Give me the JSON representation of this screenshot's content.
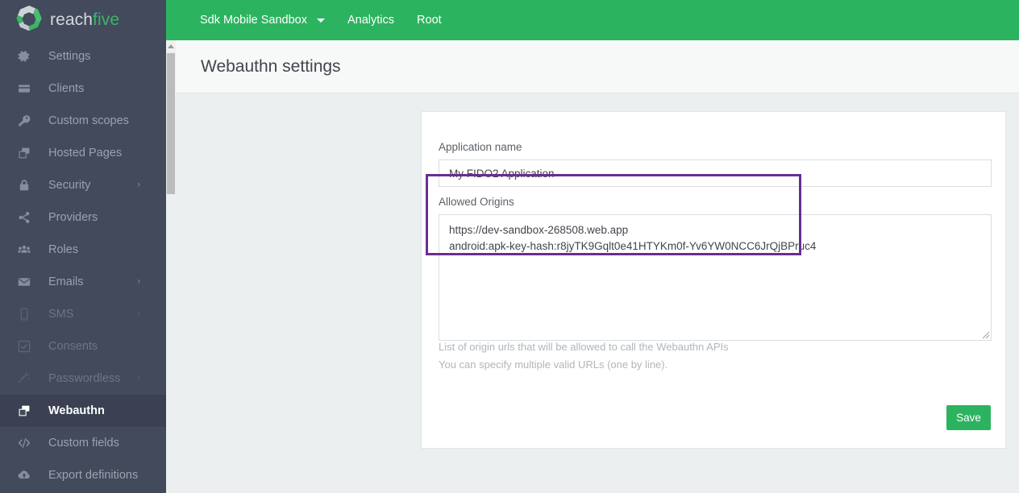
{
  "brand": {
    "name_part1": "reach",
    "name_part2": "five",
    "logo_icon": "reachfive-octagon-logo"
  },
  "sidebar": {
    "items": [
      {
        "label": "Settings",
        "icon": "gear-icon",
        "state": "normal",
        "caret": ""
      },
      {
        "label": "Clients",
        "icon": "wallet-icon",
        "state": "normal",
        "caret": ""
      },
      {
        "label": "Custom scopes",
        "icon": "key-icon",
        "state": "normal",
        "caret": ""
      },
      {
        "label": "Hosted Pages",
        "icon": "pages-stack-icon",
        "state": "normal",
        "caret": ""
      },
      {
        "label": "Security",
        "icon": "lock-icon",
        "state": "normal",
        "caret": "›"
      },
      {
        "label": "Providers",
        "icon": "share-nodes-icon",
        "state": "normal",
        "caret": ""
      },
      {
        "label": "Roles",
        "icon": "users-group-icon",
        "state": "normal",
        "caret": ""
      },
      {
        "label": "Emails",
        "icon": "envelope-icon",
        "state": "normal",
        "caret": "›"
      },
      {
        "label": "SMS",
        "icon": "mobile-phone-icon",
        "state": "disabled",
        "caret": "›"
      },
      {
        "label": "Consents",
        "icon": "checkbox-icon",
        "state": "disabled",
        "caret": ""
      },
      {
        "label": "Passwordless",
        "icon": "magic-wand-icon",
        "state": "disabled",
        "caret": "›"
      },
      {
        "label": "Webauthn",
        "icon": "pages-stack-icon",
        "state": "active",
        "caret": ""
      },
      {
        "label": "Custom fields",
        "icon": "code-brackets-icon",
        "state": "normal",
        "caret": ""
      },
      {
        "label": "Export definitions",
        "icon": "cloud-upload-icon",
        "state": "normal",
        "caret": ""
      }
    ]
  },
  "topbar": {
    "items": [
      {
        "label": "Sdk Mobile Sandbox",
        "has_dropdown": true,
        "icon": "chevron-down-icon"
      },
      {
        "label": "Analytics",
        "has_dropdown": false,
        "icon": ""
      },
      {
        "label": "Root",
        "has_dropdown": false,
        "icon": ""
      }
    ]
  },
  "page": {
    "title": "Webauthn settings"
  },
  "form": {
    "application_name": {
      "label": "Application name",
      "value": "My FIDO2 Application",
      "placeholder": ""
    },
    "allowed_origins": {
      "label": "Allowed Origins",
      "value": "https://dev-sandbox-268508.web.app\nandroid:apk-key-hash:r8jyTK9Gqlt0e41HTYKm0f-Yv6YW0NCC6JrQjBPruc4",
      "placeholder": "",
      "help_line_1": "List of origin urls that will be allowed to call the Webauthn APIs",
      "help_line_2": "You can specify multiple valid URLs (one by line)."
    },
    "save_label": "Save"
  },
  "annotation": {
    "highlight_color": "#6b2d91",
    "target": "allowed-origins-field"
  },
  "colors": {
    "sidebar_bg": "#434a5c",
    "sidebar_active_bg": "#3b4152",
    "brand_green": "#2cb35f",
    "logo_green": "#3cb464",
    "page_bg": "#eceff0",
    "header_bg": "#f7f8f8",
    "card_bg": "#ffffff"
  }
}
